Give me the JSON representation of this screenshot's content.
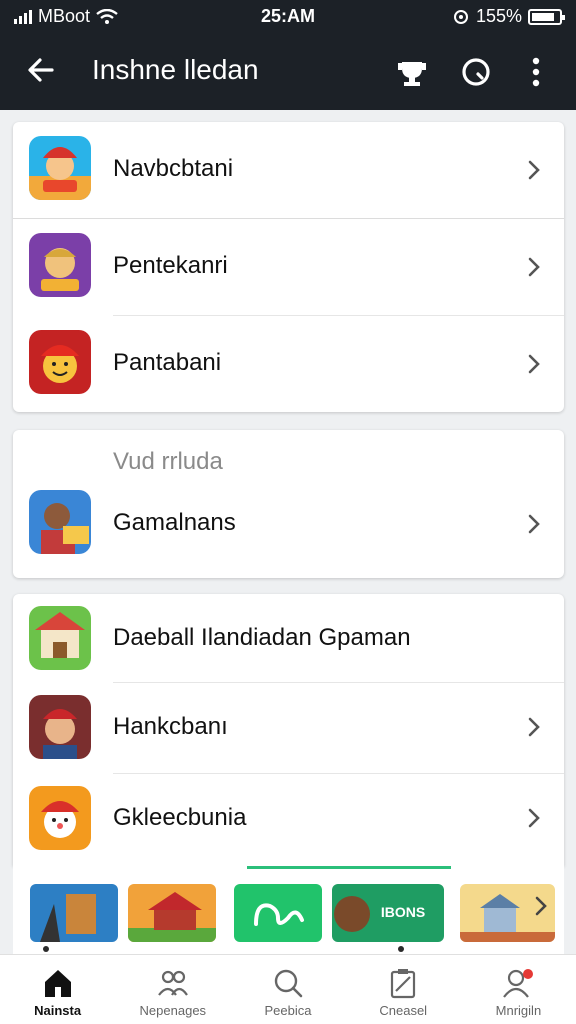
{
  "status_bar": {
    "carrier": "MBoot",
    "time": "25:AM",
    "battery_percent": "155%",
    "battery_level": 0.85
  },
  "app_bar": {
    "title": "Inshne lledan",
    "back_icon": "arrow-left-icon",
    "actions": [
      "trophy-icon",
      "search-icon",
      "more-vertical-icon"
    ]
  },
  "group1": {
    "items": [
      {
        "label": "Navbcbtani",
        "icon": "game-icon-1"
      },
      {
        "label": "Pentekanri",
        "icon": "game-icon-2"
      },
      {
        "label": "Pantabani",
        "icon": "game-icon-3"
      }
    ]
  },
  "group2": {
    "section_label": "Vud rrluda",
    "items": [
      {
        "label": "Gamalnans",
        "icon": "game-icon-4"
      }
    ]
  },
  "group3": {
    "items": [
      {
        "label": "Daeball Ilandiadan Gpaman",
        "icon": "game-icon-5"
      },
      {
        "label": "Hankcbanı",
        "icon": "game-icon-6"
      },
      {
        "label": "Gkleecbunia",
        "icon": "game-icon-7"
      }
    ]
  },
  "carousel": {
    "tiles": [
      {
        "name": "knight-tile",
        "text": ""
      },
      {
        "name": "temple-tile",
        "text": ""
      },
      {
        "name": "wave-tile",
        "text": ""
      },
      {
        "name": "promo-tile",
        "text": "IBONS"
      },
      {
        "name": "house-tile",
        "text": ""
      }
    ]
  },
  "bottom_nav": {
    "items": [
      {
        "label": "Nainsta",
        "icon": "home-icon",
        "active": true
      },
      {
        "label": "Nepenages",
        "icon": "people-icon",
        "active": false
      },
      {
        "label": "Peebica",
        "icon": "search-icon",
        "active": false
      },
      {
        "label": "Cneasel",
        "icon": "clipboard-icon",
        "active": false
      },
      {
        "label": "Mnrigiln",
        "icon": "profile-icon",
        "active": false
      }
    ]
  },
  "colors": {
    "header_bg": "#1c2127",
    "accent_green": "#2bbf7a",
    "notification_red": "#e53935"
  }
}
